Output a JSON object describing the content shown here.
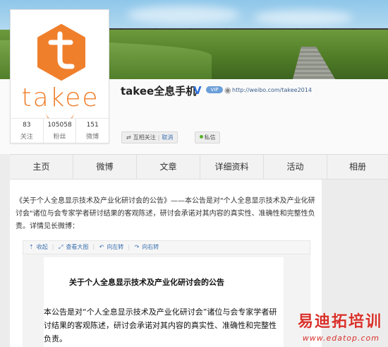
{
  "profile": {
    "username": "takee全息手机",
    "verified_mark": "V",
    "vip_badge": "VIP",
    "url": "http://weibo.com/takee2014",
    "brand_word": "takee",
    "stats": [
      {
        "num": "83",
        "label": "关注"
      },
      {
        "num": "105058",
        "label": "粉丝"
      },
      {
        "num": "151",
        "label": "微博"
      }
    ],
    "follow_label": "互相关注",
    "cancel_label": "取消",
    "message_label": "私信"
  },
  "nav": {
    "tabs": [
      "主页",
      "微博",
      "文章",
      "详细资料",
      "活动",
      "相册"
    ]
  },
  "post": {
    "text": "《关于个人全息显示技术及产业化研讨会的公告》——本公告是对\"个人全息显示技术及产业化研讨会\"诸位与会专家学者研讨结果的客观陈述，研讨会承诺对其内容的真实性、准确性和完整性负责。详情见长微博：",
    "toolbar": {
      "collapse": "收起",
      "view_large": "查看大图",
      "rotate_left": "向左转",
      "rotate_right": "向右转"
    },
    "doc_title": "关于个人全息显示技术及产业化研讨会的公告",
    "doc_body": "本公告是对“个人全息显示技术及产业化研讨会”诸位与会专家学者研讨结果的客观陈述，研讨会承诺对其内容的真实性、准确性和完整性负责。"
  },
  "watermark": {
    "text": "易迪拓培训",
    "url": "www.edatop.com"
  },
  "colors": {
    "brand_orange": "#f07f2c",
    "link_blue": "#3a6fb0",
    "watermark_red": "#d9312b"
  }
}
